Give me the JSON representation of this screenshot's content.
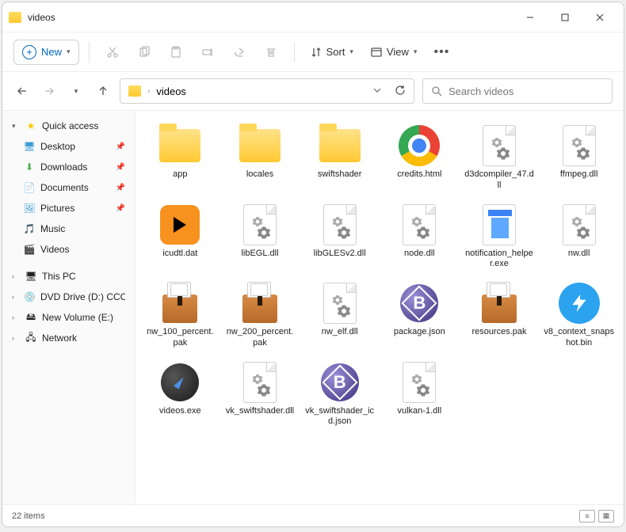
{
  "window": {
    "title": "videos"
  },
  "toolbar": {
    "new": "New",
    "sort": "Sort",
    "view": "View"
  },
  "address": {
    "path": "videos",
    "search_placeholder": "Search videos"
  },
  "sidebar": {
    "quick": "Quick access",
    "desktop": "Desktop",
    "downloads": "Downloads",
    "documents": "Documents",
    "pictures": "Pictures",
    "music": "Music",
    "videos": "Videos",
    "thispc": "This PC",
    "dvd": "DVD Drive (D:) CCCC",
    "newvol": "New Volume (E:)",
    "network": "Network"
  },
  "files": [
    {
      "name": "app",
      "icon": "folder"
    },
    {
      "name": "locales",
      "icon": "folder"
    },
    {
      "name": "swiftshader",
      "icon": "folder"
    },
    {
      "name": "credits.html",
      "icon": "chrome"
    },
    {
      "name": "d3dcompiler_47.dll",
      "icon": "dll"
    },
    {
      "name": "ffmpeg.dll",
      "icon": "dll"
    },
    {
      "name": "icudtl.dat",
      "icon": "play"
    },
    {
      "name": "libEGL.dll",
      "icon": "dll"
    },
    {
      "name": "libGLESv2.dll",
      "icon": "dll"
    },
    {
      "name": "node.dll",
      "icon": "dll"
    },
    {
      "name": "notification_helper.exe",
      "icon": "notif"
    },
    {
      "name": "nw.dll",
      "icon": "dll"
    },
    {
      "name": "nw_100_percent.pak",
      "icon": "pak"
    },
    {
      "name": "nw_200_percent.pak",
      "icon": "pak"
    },
    {
      "name": "nw_elf.dll",
      "icon": "dll"
    },
    {
      "name": "package.json",
      "icon": "bb"
    },
    {
      "name": "resources.pak",
      "icon": "pak"
    },
    {
      "name": "v8_context_snapshot.bin",
      "icon": "bolt"
    },
    {
      "name": "videos.exe",
      "icon": "compass"
    },
    {
      "name": "vk_swiftshader.dll",
      "icon": "dll"
    },
    {
      "name": "vk_swiftshader_icd.json",
      "icon": "bb"
    },
    {
      "name": "vulkan-1.dll",
      "icon": "dll"
    }
  ],
  "status": {
    "count": "22 items"
  }
}
